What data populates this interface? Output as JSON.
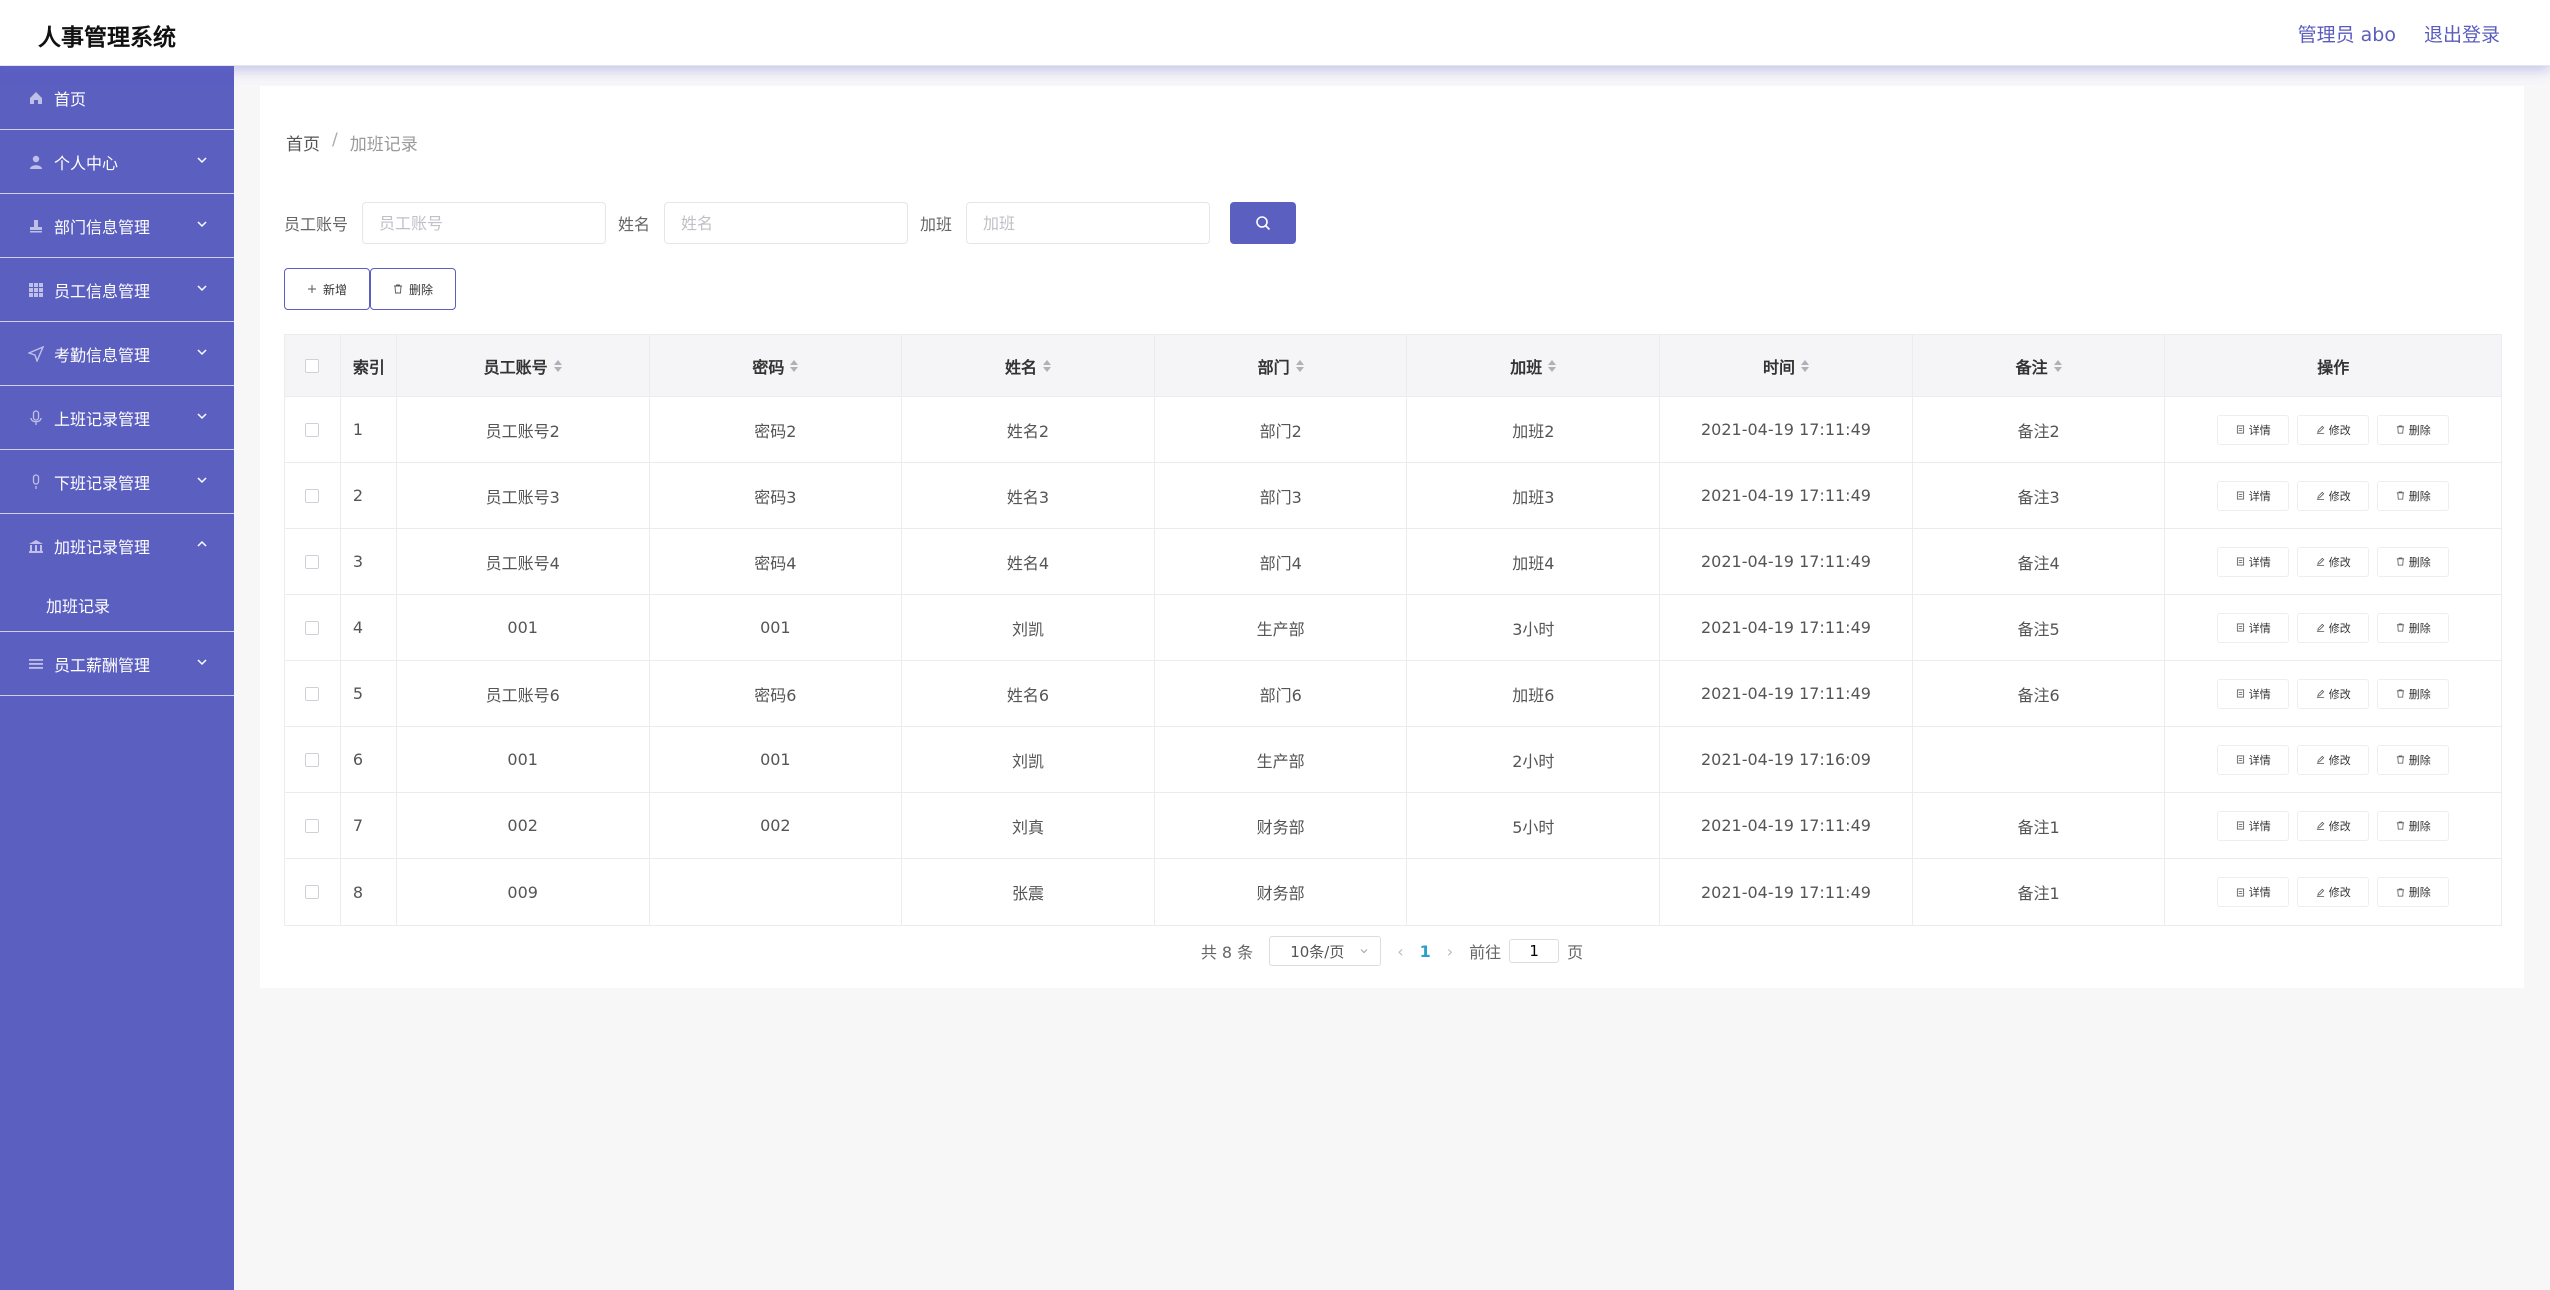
{
  "header": {
    "title": "人事管理系统",
    "user": "管理员 abo",
    "logout": "退出登录"
  },
  "sidebar": {
    "items": [
      {
        "label": "首页",
        "icon": "home-icon"
      },
      {
        "label": "个人中心",
        "icon": "user-icon"
      },
      {
        "label": "部门信息管理",
        "icon": "stamp-icon"
      },
      {
        "label": "员工信息管理",
        "icon": "grid-icon"
      },
      {
        "label": "考勤信息管理",
        "icon": "send-icon"
      },
      {
        "label": "上班记录管理",
        "icon": "microphone-icon"
      },
      {
        "label": "下班记录管理",
        "icon": "mic-off-icon"
      },
      {
        "label": "加班记录管理",
        "icon": "bank-icon"
      },
      {
        "label": "员工薪酬管理",
        "icon": "menu-icon"
      }
    ],
    "sub_item": "加班记录"
  },
  "breadcrumb": {
    "home": "首页",
    "sep": "/",
    "current": "加班记录"
  },
  "search": {
    "fields": [
      {
        "label": "员工账号",
        "placeholder": "员工账号"
      },
      {
        "label": "姓名",
        "placeholder": "姓名"
      },
      {
        "label": "加班",
        "placeholder": "加班"
      }
    ]
  },
  "buttons": {
    "add": "新增",
    "delete": "删除"
  },
  "table": {
    "headers": {
      "index": "索引",
      "account": "员工账号",
      "password": "密码",
      "name": "姓名",
      "dept": "部门",
      "overtime": "加班",
      "time": "时间",
      "remark": "备注",
      "ops": "操作"
    },
    "actions": {
      "detail": "详情",
      "edit": "修改",
      "delete": "删除"
    },
    "rows": [
      {
        "index": "1",
        "account": "员工账号2",
        "password": "密码2",
        "name": "姓名2",
        "dept": "部门2",
        "overtime": "加班2",
        "time": "2021-04-19 17:11:49",
        "remark": "备注2"
      },
      {
        "index": "2",
        "account": "员工账号3",
        "password": "密码3",
        "name": "姓名3",
        "dept": "部门3",
        "overtime": "加班3",
        "time": "2021-04-19 17:11:49",
        "remark": "备注3"
      },
      {
        "index": "3",
        "account": "员工账号4",
        "password": "密码4",
        "name": "姓名4",
        "dept": "部门4",
        "overtime": "加班4",
        "time": "2021-04-19 17:11:49",
        "remark": "备注4"
      },
      {
        "index": "4",
        "account": "001",
        "password": "001",
        "name": "刘凯",
        "dept": "生产部",
        "overtime": "3小时",
        "time": "2021-04-19 17:11:49",
        "remark": "备注5"
      },
      {
        "index": "5",
        "account": "员工账号6",
        "password": "密码6",
        "name": "姓名6",
        "dept": "部门6",
        "overtime": "加班6",
        "time": "2021-04-19 17:11:49",
        "remark": "备注6"
      },
      {
        "index": "6",
        "account": "001",
        "password": "001",
        "name": "刘凯",
        "dept": "生产部",
        "overtime": "2小时",
        "time": "2021-04-19 17:16:09",
        "remark": ""
      },
      {
        "index": "7",
        "account": "002",
        "password": "002",
        "name": "刘真",
        "dept": "财务部",
        "overtime": "5小时",
        "time": "2021-04-19 17:11:49",
        "remark": "备注1"
      },
      {
        "index": "8",
        "account": "009",
        "password": "",
        "name": "张震",
        "dept": "财务部",
        "overtime": "",
        "time": "2021-04-19 17:11:49",
        "remark": "备注1"
      }
    ]
  },
  "pagination": {
    "total": "共 8 条",
    "page_size": "10条/页",
    "current": "1",
    "goto_label": "前往",
    "goto_value": "1",
    "page_unit": "页"
  },
  "colors": {
    "accent": "#5b5fc0",
    "page_active": "#2aa0c8"
  }
}
